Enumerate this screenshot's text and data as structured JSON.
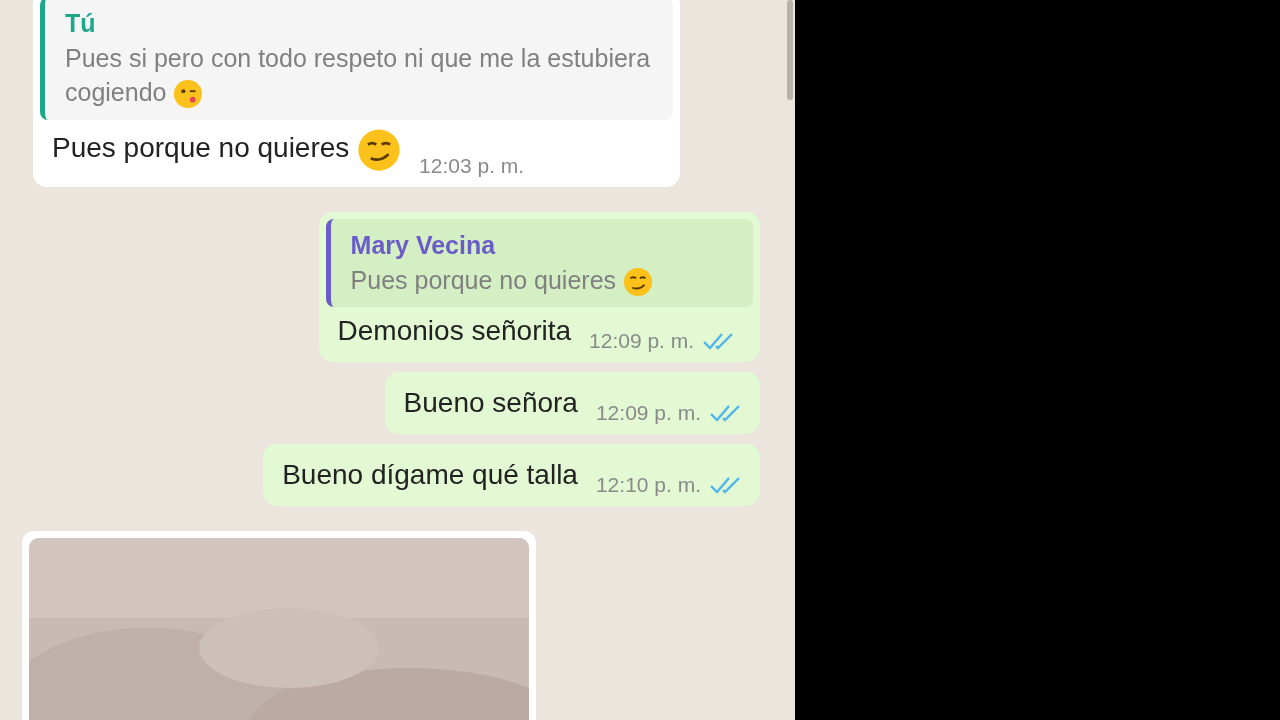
{
  "messages": [
    {
      "kind": "incoming",
      "quote": {
        "author": "Tú",
        "text": "Pues si pero con todo respeto ni que me la estubiera cogiendo",
        "emoji": {
          "kind": "wink"
        }
      },
      "text": "Pues porque no quieres",
      "emoji": {
        "kind": "smirk"
      },
      "time": "12:03 p. m."
    },
    {
      "kind": "outgoing",
      "quote": {
        "author": "Mary Vecina",
        "text": "Pues porque no quieres",
        "emoji": {
          "kind": "smirk"
        }
      },
      "text": "Demonios señorita",
      "time": "12:09 p. m.",
      "read": true
    },
    {
      "kind": "outgoing",
      "text": "Bueno señora",
      "time": "12:09 p. m.",
      "read": true
    },
    {
      "kind": "outgoing",
      "text": "Bueno dígame qué talla",
      "time": "12:10 p. m.",
      "read": true
    },
    {
      "kind": "incoming-image"
    }
  ]
}
